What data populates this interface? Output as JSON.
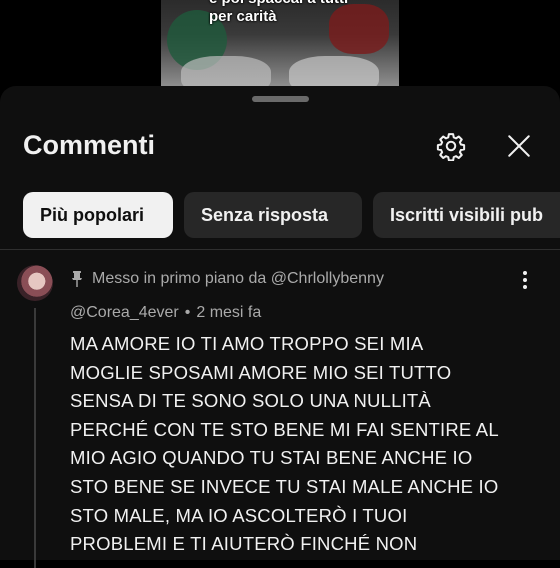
{
  "video": {
    "caption_lines": [
      "e poi spaccai a tutti",
      "per carità"
    ]
  },
  "sheet": {
    "title": "Commenti",
    "icons": {
      "settings": "gear-icon",
      "close": "close-icon"
    }
  },
  "filters": [
    {
      "label": "Più popolari",
      "active": true
    },
    {
      "label": "Senza risposta",
      "active": false
    },
    {
      "label": "Iscritti visibili pub",
      "active": false
    }
  ],
  "comment": {
    "pinned_text": "Messo in primo piano da @Chrlollybenny",
    "author": "@Corea_4ever",
    "separator": "•",
    "time": "2 mesi fa",
    "lines": [
      "MA AMORE IO TI AMO TROPPO SEI MIA",
      "MOGLIE SPOSAMI AMORE MIO SEI TUTTO",
      "SENSA DI TE SONO SOLO UNA NULLITÀ",
      "PERCHÉ CON TE STO BENE MI FAI SENTIRE AL",
      "MIO AGIO QUANDO TU STAI BENE ANCHE IO",
      "STO BENE SE INVECE TU STAI MALE ANCHE IO",
      "STO MALE, MA IO ASCOLTERÒ I TUOI",
      "PROBLEMI E TI AIUTERÒ FINCHÉ NON"
    ]
  },
  "colors": {
    "sheet_bg": "#0f0f0f",
    "chip_bg": "#272727",
    "chip_active_bg": "#f1f1f1",
    "secondary_text": "#aaaaaa"
  }
}
